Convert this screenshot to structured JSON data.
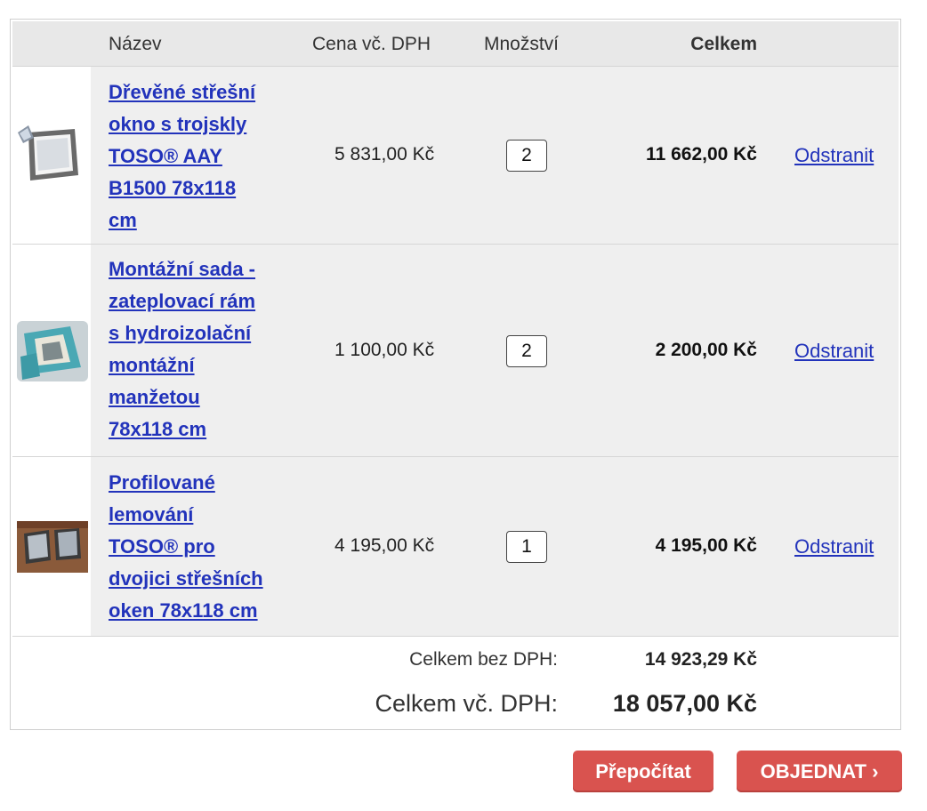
{
  "header": {
    "name": "Název",
    "price": "Cena vč. DPH",
    "quantity": "Množství",
    "total": "Celkem"
  },
  "items": [
    {
      "name": "Dřevěné střešní\nokno s trojskly\nTOSO® AAY\nB1500 78x118\ncm",
      "price": "5 831,00 Kč",
      "quantity": "2",
      "total": "11 662,00 Kč",
      "remove_label": "Odstranit",
      "icon": "roof-window-icon"
    },
    {
      "name": "Montážní sada -\nzateplovací rám\ns hydroizolační\nmontážní\nmanžetou\n78x118 cm",
      "price": "1 100,00 Kč",
      "quantity": "2",
      "total": "2 200,00 Kč",
      "remove_label": "Odstranit",
      "icon": "insulation-kit-icon"
    },
    {
      "name": "Profilované\nlemování\nTOSO® pro\ndvojici střešních\noken 78x118 cm",
      "price": "4 195,00 Kč",
      "quantity": "1",
      "total": "4 195,00 Kč",
      "remove_label": "Odstranit",
      "icon": "flashing-icon"
    }
  ],
  "summary": {
    "subtotal_label": "Celkem bez DPH:",
    "subtotal_value": "14 923,29 Kč",
    "total_label": "Celkem vč. DPH:",
    "total_value": "18 057,00 Kč"
  },
  "buttons": {
    "recalculate": "Přepočítat",
    "order": "OBJEDNAT ›"
  },
  "colors": {
    "link": "#2233bb",
    "button": "#d9534f",
    "header_bg": "#e8e8e8",
    "row_bg": "#efefef"
  }
}
